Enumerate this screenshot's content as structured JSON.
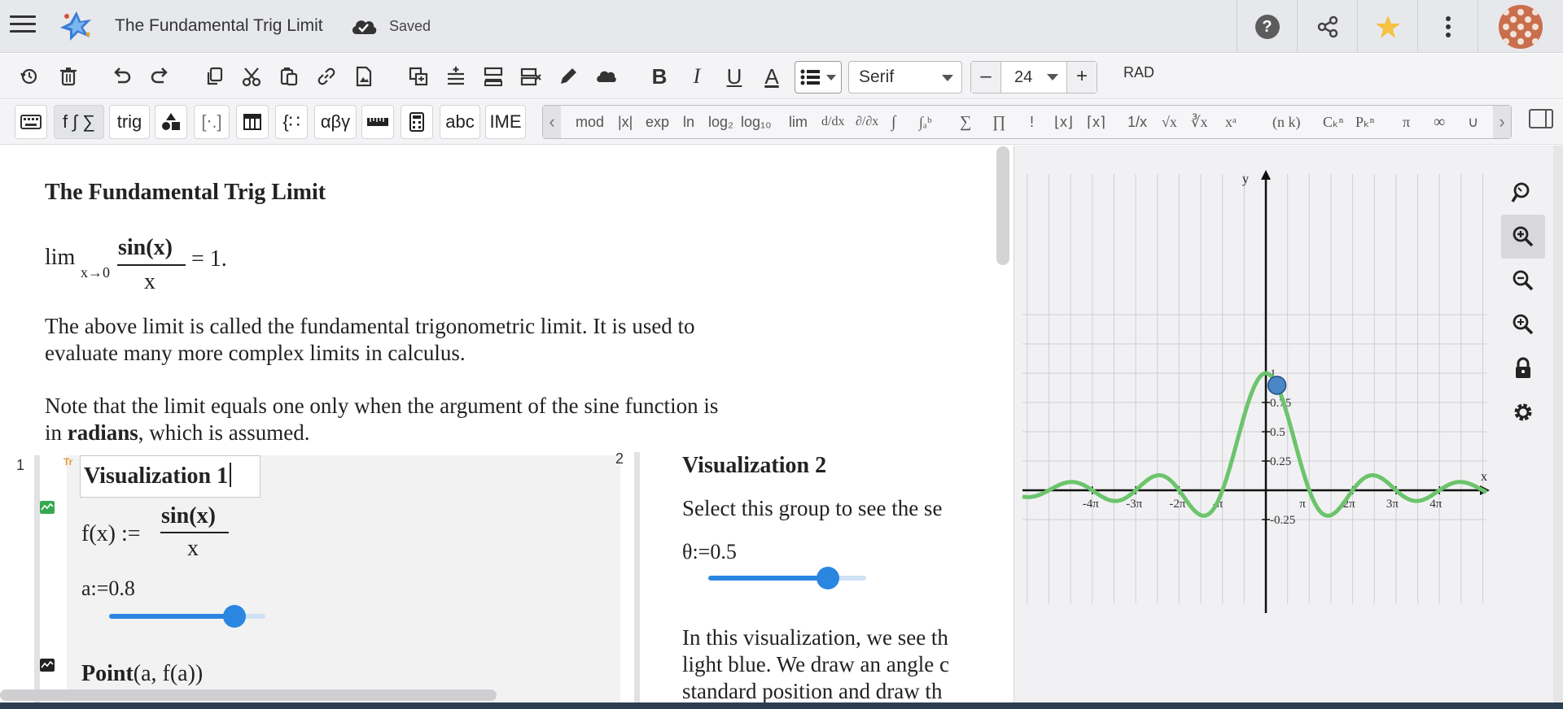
{
  "app": {
    "doc_title": "The Fundamental Trig Limit",
    "saved_status": "Saved"
  },
  "toolbar": {
    "font_family": "Serif",
    "font_size": "24",
    "size_minus": "–",
    "size_plus": "+",
    "angle_mode": "RAD",
    "bold": "B",
    "italic": "I",
    "underline": "U",
    "color": "A"
  },
  "keyboard_tabs": [
    "f ∫ ∑",
    "trig",
    "[⋅.]",
    "{∷",
    "αβγ",
    "abc",
    "IME"
  ],
  "palette": {
    "items": [
      "mod",
      "|x|",
      "exp",
      "ln",
      "log₂",
      "log₁₀",
      "lim",
      "d/dx",
      "∂/∂x",
      "∫",
      "∫ₐᵇ",
      "∑",
      "∏",
      "!",
      "⌊x⌋",
      "⌈x⌉",
      "1/x",
      "√x",
      "∛x",
      "xᵃ",
      "(n k)",
      "Cₖⁿ",
      "Pₖⁿ",
      "π",
      "∞",
      "∪"
    ]
  },
  "document": {
    "heading": "The Fundamental Trig Limit",
    "limit": {
      "lim": "lim",
      "subscript": "x→0",
      "numerator": "sin(x)",
      "denominator": "x",
      "rhs": "= 1."
    },
    "para1_line1": "The above limit is called the fundamental trigonometric limit. It is used to",
    "para1_line2": "evaluate many more complex limits in calculus.",
    "para2_line1": "Note that the limit equals one only when the argument of the sine function is",
    "para2_line2_pre": "in ",
    "para2_line2_bold": "radians",
    "para2_line2_post": ", which is assumed.",
    "group1": {
      "number": "1",
      "title": "Visualization 1",
      "fx_lhs": "f(x) :=",
      "fx_num": "sin(x)",
      "fx_den": "x",
      "param": "a:=0.8",
      "param_fraction": 0.8,
      "point_fn": "Point",
      "point_args": "(a, f(a))"
    },
    "group2": {
      "number": "2",
      "title": "Visualization 2",
      "line1": "Select this group to see the se",
      "param": "θ:=0.5",
      "param_fraction": 0.76,
      "text_line1": "In this visualization, we see th",
      "text_line2": "light blue. We draw an angle c",
      "text_line3": "standard position and draw th"
    }
  },
  "graph": {
    "x_label": "x",
    "y_label": "y",
    "x_ticks": [
      "-4π",
      "-3π",
      "-2π",
      "-π",
      "π",
      "2π",
      "3π",
      "4π"
    ],
    "y_ticks": [
      "1",
      "0.75",
      "0.5",
      "0.25",
      "-0.25"
    ],
    "curve_color": "#6cc46c",
    "point_color": "#4a86c5",
    "point_x": 0.8
  },
  "colors": {
    "accent": "#2b86e2",
    "star": "#f5c242",
    "title_bar": "#e7e8ec"
  }
}
